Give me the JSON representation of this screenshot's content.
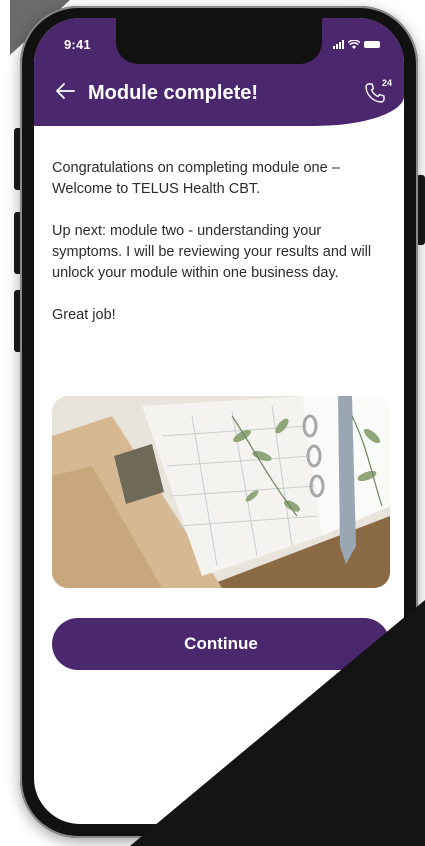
{
  "status_bar": {
    "time": "9:41"
  },
  "header": {
    "title": "Module complete!",
    "call_badge": "24"
  },
  "content": {
    "paragraph_1": "Congratulations on completing module one – Welcome to TELUS Health CBT.",
    "paragraph_2": "Up next: module two - understanding your symptoms. I will be reviewing your results and will unlock your module within one business day.",
    "paragraph_3": "Great job!"
  },
  "illustration": {
    "icon": "notebook-plants-photo"
  },
  "actions": {
    "continue_label": "Continue"
  },
  "colors": {
    "brand": "#4b286d",
    "text": "#2a2c2e"
  }
}
